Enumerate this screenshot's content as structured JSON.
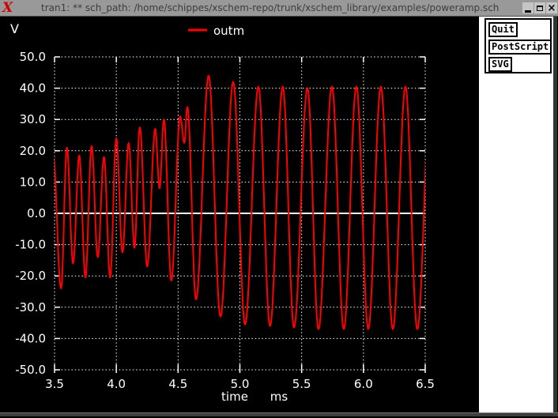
{
  "window": {
    "title": "tran1: ** sch_path: /home/schippes/xschem-repo/trunk/xschem_library/examples/poweramp.sch",
    "app_icon": "xterm-x-logo",
    "app_icon_glyph": "X",
    "controls": [
      {
        "name": "minimize"
      },
      {
        "name": "maximize"
      },
      {
        "name": "close",
        "glyph": "×"
      }
    ]
  },
  "side_panel": {
    "buttons": [
      "Quit",
      "PostScript",
      "SVG"
    ]
  },
  "colors": {
    "trace": "#ff0000",
    "plot_background": "#000000",
    "plot_foreground": "#ffffff",
    "titlebar": "#999999",
    "panel_background": "#ffffff"
  },
  "chart_data": {
    "type": "line",
    "title": "",
    "ylabel": "V",
    "xlabel": "time",
    "x_unit": "ms",
    "xlim": [
      3.5,
      6.5
    ],
    "ylim": [
      -50.0,
      50.0
    ],
    "x_ticks": [
      3.5,
      4.0,
      4.5,
      5.0,
      5.5,
      6.0,
      6.5
    ],
    "y_ticks": [
      50.0,
      40.0,
      30.0,
      20.0,
      10.0,
      0.0,
      -10.0,
      -20.0,
      -30.0,
      -40.0,
      -50.0
    ],
    "grid": "dotted",
    "zero_axis_line": true,
    "legend_position": "top-center",
    "series": [
      {
        "name": "outm",
        "color": "#ff0000",
        "interpolation": "half-cosine-between-extrema",
        "keypoints": [
          [
            3.485,
            21
          ],
          [
            3.553,
            -24
          ],
          [
            3.6,
            21
          ],
          [
            3.65,
            -16
          ],
          [
            3.7,
            18.5
          ],
          [
            3.75,
            -20.5
          ],
          [
            3.8,
            21.5
          ],
          [
            3.85,
            -14
          ],
          [
            3.9,
            18
          ],
          [
            3.95,
            -20.5
          ],
          [
            4.0,
            24
          ],
          [
            4.05,
            -12.5
          ],
          [
            4.1,
            22.5
          ],
          [
            4.147,
            -11
          ],
          [
            4.19,
            27.5
          ],
          [
            4.25,
            -17
          ],
          [
            4.315,
            27
          ],
          [
            4.35,
            8
          ],
          [
            4.385,
            30
          ],
          [
            4.445,
            -21.5
          ],
          [
            4.517,
            31
          ],
          [
            4.55,
            22.5
          ],
          [
            4.575,
            34
          ],
          [
            4.645,
            -27.5
          ],
          [
            4.747,
            44
          ],
          [
            4.843,
            -33
          ],
          [
            4.946,
            42
          ],
          [
            5.042,
            -35.5
          ],
          [
            5.15,
            40.5
          ],
          [
            5.244,
            -36
          ],
          [
            5.347,
            40.5
          ],
          [
            5.438,
            -36.5
          ],
          [
            5.547,
            40
          ],
          [
            5.636,
            -37
          ],
          [
            5.745,
            40.5
          ],
          [
            5.841,
            -37
          ],
          [
            5.943,
            40.5
          ],
          [
            6.039,
            -37
          ],
          [
            6.141,
            40.5
          ],
          [
            6.238,
            -37
          ],
          [
            6.34,
            40.5
          ],
          [
            6.436,
            -37
          ],
          [
            6.545,
            40
          ]
        ]
      }
    ]
  }
}
